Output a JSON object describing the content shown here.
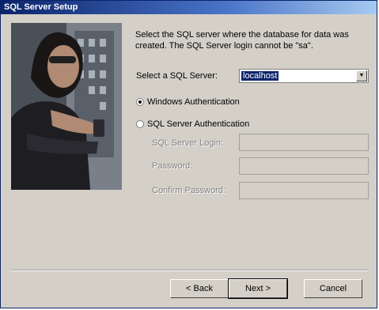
{
  "window": {
    "title": "SQL Server Setup"
  },
  "description": "Select the SQL server where the database for data was created.  The SQL Server login cannot be \"sa\".",
  "server": {
    "label": "Select a SQL Server:",
    "selected": "localhost"
  },
  "auth": {
    "windows_label": "Windows Authentication",
    "sql_label": "SQL Server Authentication",
    "selected": "windows"
  },
  "fields": {
    "login_label": "SQL Server Login:",
    "password_label": "Password:",
    "confirm_label": "Confirm Password:"
  },
  "buttons": {
    "back": "< Back",
    "next": "Next >",
    "cancel": "Cancel"
  },
  "colors": {
    "title_bar": "#0a246a",
    "dialog_bg": "#d4d0c8",
    "selection": "#0a246a"
  }
}
